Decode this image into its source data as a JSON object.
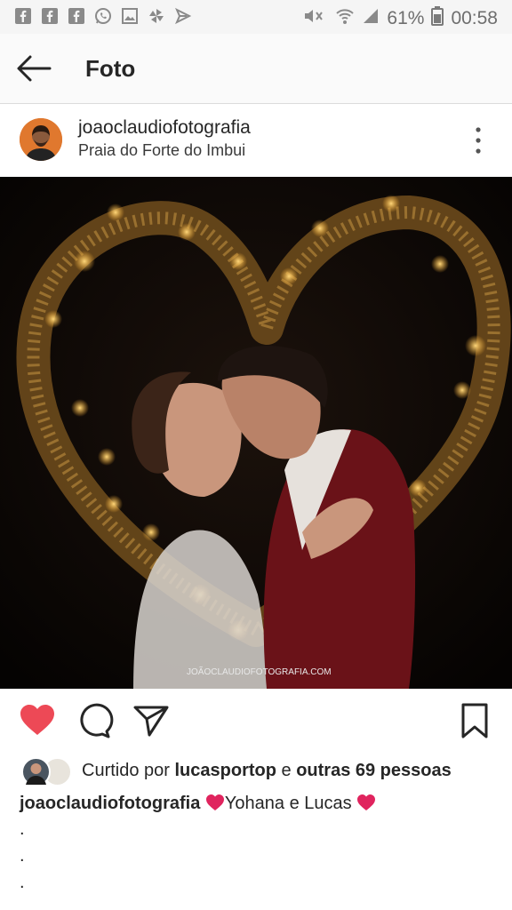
{
  "status_bar": {
    "battery_percent": "61%",
    "time": "00:58",
    "left_icons": [
      "facebook-icon",
      "facebook-icon",
      "facebook-icon",
      "whatsapp-icon",
      "gallery-icon",
      "pinwheel-icon",
      "send-icon"
    ],
    "right_icons": [
      "mute-icon",
      "wifi-icon",
      "signal-icon",
      "battery-icon"
    ]
  },
  "app_bar": {
    "title": "Foto"
  },
  "post": {
    "username": "joaoclaudiofotografia",
    "location": "Praia do Forte do Imbui",
    "photo_watermark": "JOÃOCLAUDIOFOTOGRAFIA.COM",
    "liked": true,
    "likes": {
      "prefix": "Curtido por ",
      "user": "lucasportop",
      "connector": " e ",
      "others": "outras 69 pessoas"
    },
    "caption": {
      "user": "joaoclaudiofotografia",
      "text": "Yohana e Lucas"
    },
    "more_lines": [
      ".",
      ".",
      "."
    ]
  },
  "colors": {
    "like_red": "#ed4956",
    "accent_text": "#262626"
  }
}
